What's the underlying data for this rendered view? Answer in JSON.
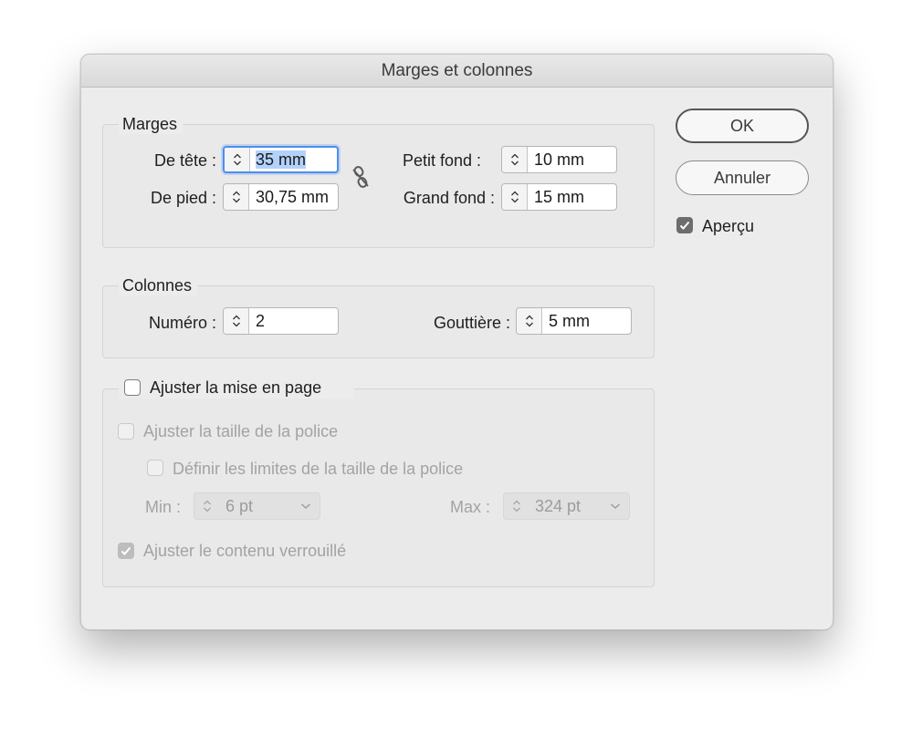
{
  "dialog": {
    "title": "Marges et colonnes",
    "ok_label": "OK",
    "cancel_label": "Annuler",
    "preview_label": "Aperçu",
    "preview_checked": true
  },
  "margins": {
    "legend": "Marges",
    "top_label": "De tête :",
    "top_value": "35 mm",
    "bottom_label": "De pied :",
    "bottom_value": "30,75 mm",
    "inside_label": "Petit fond :",
    "inside_value": "10 mm",
    "outside_label": "Grand fond :",
    "outside_value": "15 mm",
    "link_icon": "broken-chain-link-icon"
  },
  "columns": {
    "legend": "Colonnes",
    "number_label": "Numéro :",
    "number_value": "2",
    "gutter_label": "Gouttière :",
    "gutter_value": "5 mm"
  },
  "adjust": {
    "legend": "Ajuster la mise en page",
    "enabled": false,
    "font_size_label": "Ajuster la taille de la police",
    "font_limits_label": "Définir les limites de la taille de la police",
    "min_label": "Min :",
    "min_value": "6 pt",
    "max_label": "Max :",
    "max_value": "324 pt",
    "locked_content_label": "Ajuster le contenu verrouillé",
    "locked_content_checked": true
  },
  "colors": {
    "focus": "#4c8ef0",
    "selection": "#b3d2fb",
    "disabled_text": "#a3a3a3"
  }
}
